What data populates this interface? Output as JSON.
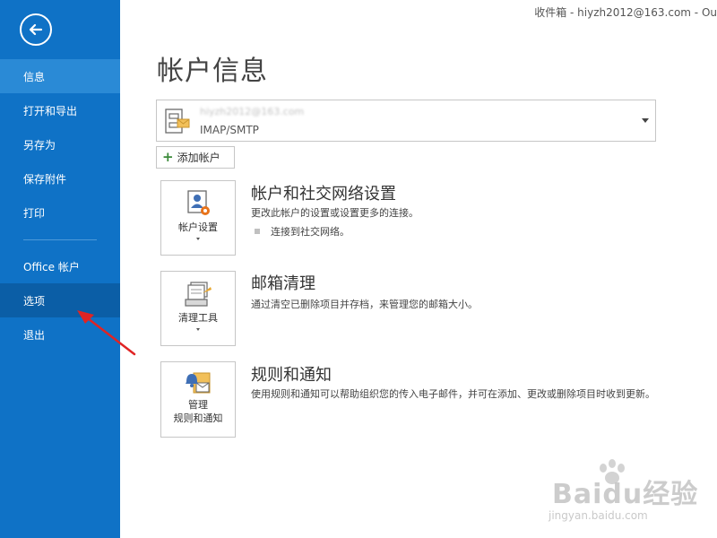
{
  "window": {
    "title": "收件箱 - hiyzh2012@163.com - Ou"
  },
  "sidebar": {
    "items": [
      {
        "label": "信息"
      },
      {
        "label": "打开和导出"
      },
      {
        "label": "另存为"
      },
      {
        "label": "保存附件"
      },
      {
        "label": "打印"
      },
      {
        "label": "Office 帐户"
      },
      {
        "label": "选项"
      },
      {
        "label": "退出"
      }
    ],
    "active_item": "信息",
    "highlighted_item": "选项"
  },
  "main": {
    "title": "帐户信息",
    "account": {
      "email": "hiyzh2012@163.com",
      "type": "IMAP/SMTP"
    },
    "add_account_label": "添加帐户",
    "sections": [
      {
        "button_label": "帐户设置",
        "title": "帐户和社交网络设置",
        "description": "更改此帐户的设置或设置更多的连接。",
        "bullet": "连接到社交网络。"
      },
      {
        "button_label": "清理工具",
        "title": "邮箱清理",
        "description": "通过清空已删除项目并存档，来管理您的邮箱大小。"
      },
      {
        "button_label_line1": "管理",
        "button_label_line2": "规则和通知",
        "title": "规则和通知",
        "description": "使用规则和通知可以帮助组织您的传入电子邮件，并可在添加、更改或删除项目时收到更新。"
      }
    ]
  },
  "watermark": {
    "brand": "Baidu经验",
    "url": "jingyan.baidu.com"
  },
  "colors": {
    "sidebar": "#0f72c6",
    "sidebar_active": "#2a8ad6",
    "sidebar_hover": "#0b5ea6",
    "annotation": "#e02424"
  }
}
